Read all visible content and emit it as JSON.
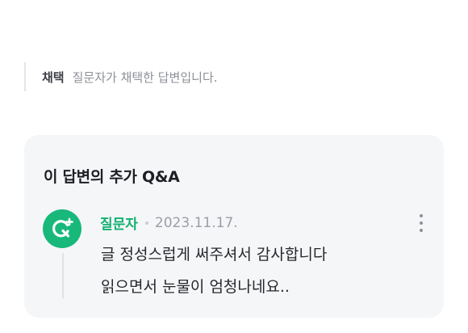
{
  "adopted": {
    "tag": "채택",
    "description": "질문자가 채택한 답변입니다."
  },
  "qa": {
    "title": "이 답변의 추가 Q&A",
    "comment": {
      "avatar_icon": "questioner-q-plus-icon",
      "avatar_color": "#18b87a",
      "author": "질문자",
      "date": "2023.11.17.",
      "lines": [
        "글 정성스럽게 써주셔서 감사합니다",
        "읽으면서 눈물이 엄청나네요.."
      ]
    },
    "more_icon": "more-vertical-icon"
  },
  "colors": {
    "accent": "#12b070",
    "card_background": "#f5f6f8"
  }
}
